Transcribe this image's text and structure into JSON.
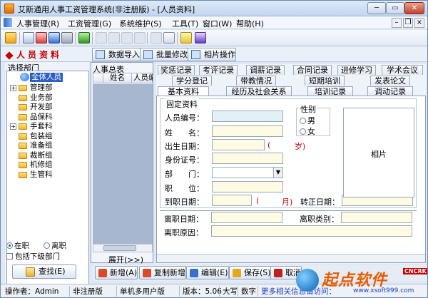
{
  "window": {
    "title": "艾斯通用人事工资管理系统(非注册版) - [人员资料]",
    "min": "─",
    "max": "▭",
    "close": "✕"
  },
  "menu": {
    "items": [
      "人事管理(R)",
      "工资管理(G)",
      "系统维护(S)",
      "工具(T)",
      "窗口(W)",
      "帮助(H)"
    ],
    "mdi_min": "–",
    "mdi_restore": "❐",
    "mdi_close": "×"
  },
  "pathbar": {
    "title": "人员资料",
    "buttons": [
      "数据导入",
      "批量修改",
      "相片操作"
    ]
  },
  "left": {
    "title": "选择部门",
    "root": "全体人员",
    "departments": [
      {
        "name": "管理部",
        "expandable": true
      },
      {
        "name": "业务部",
        "expandable": false
      },
      {
        "name": "开发部",
        "expandable": false
      },
      {
        "name": "品保科",
        "expandable": false
      },
      {
        "name": "手套科",
        "expandable": true
      },
      {
        "name": "包装组",
        "expandable": false
      },
      {
        "name": "准备组",
        "expandable": false
      },
      {
        "name": "裁断组",
        "expandable": false
      },
      {
        "name": "机修组",
        "expandable": false
      },
      {
        "name": "生管科",
        "expandable": false
      }
    ],
    "radio_active": "在职",
    "radio_left": "离职",
    "include_sub": "包括下级部门",
    "search": "查找(E)"
  },
  "list": {
    "title": "人事总表",
    "col_name": "姓名",
    "col_id": "人员编"
  },
  "expand_label": "展开(>>)",
  "tabs": {
    "row1": [
      "奖惩记录",
      "考评记录",
      "调薪记录",
      "合同记录",
      "进修学习",
      "学术会议"
    ],
    "row2": [
      "学分登记",
      "带教情况",
      "短期培训",
      "发表论文"
    ],
    "row3": [
      "基本资料",
      "经历及社会关系",
      "培训记录",
      "调动记录"
    ],
    "active": "基本资料"
  },
  "form": {
    "group_title": "固定资料",
    "fields": {
      "emp_no": "人员编号：",
      "name": "姓　　名：",
      "birth": "出生日期：",
      "id_card": "身份证号：",
      "dept": "部　　门：",
      "position": "职　　位：",
      "join_date": "到职日期：",
      "transfer_date": "转正日期：",
      "leave_date": "离职日期：",
      "leave_type": "离职类别：",
      "leave_reason": "离职原因："
    },
    "age_paren": "(",
    "age_unit": "岁)",
    "month_paren": "(",
    "month_unit": "月)",
    "gender_title": "性别",
    "male": "男",
    "female": "女",
    "photo": "相片"
  },
  "actions": [
    "新增(A)",
    "复制新增",
    "编辑(E)",
    "保存(S)",
    "取消"
  ],
  "status": {
    "operator": "操作者：Admin",
    "edition": "非注册版",
    "mode": "单机多用户版",
    "version": "版本：5.06",
    "caps": "大写",
    "num": "数字",
    "link": "更多相关信息请访问："
  },
  "watermark": {
    "text": "起点软件",
    "badge": "CNCRK",
    "url": "www.xsoft999.com"
  },
  "colors": {
    "accent_red": "#c60000",
    "selection_blue": "#2b5fc6",
    "field_yellow": "#fdfbe4",
    "field_blue": "#e3f1f7"
  }
}
